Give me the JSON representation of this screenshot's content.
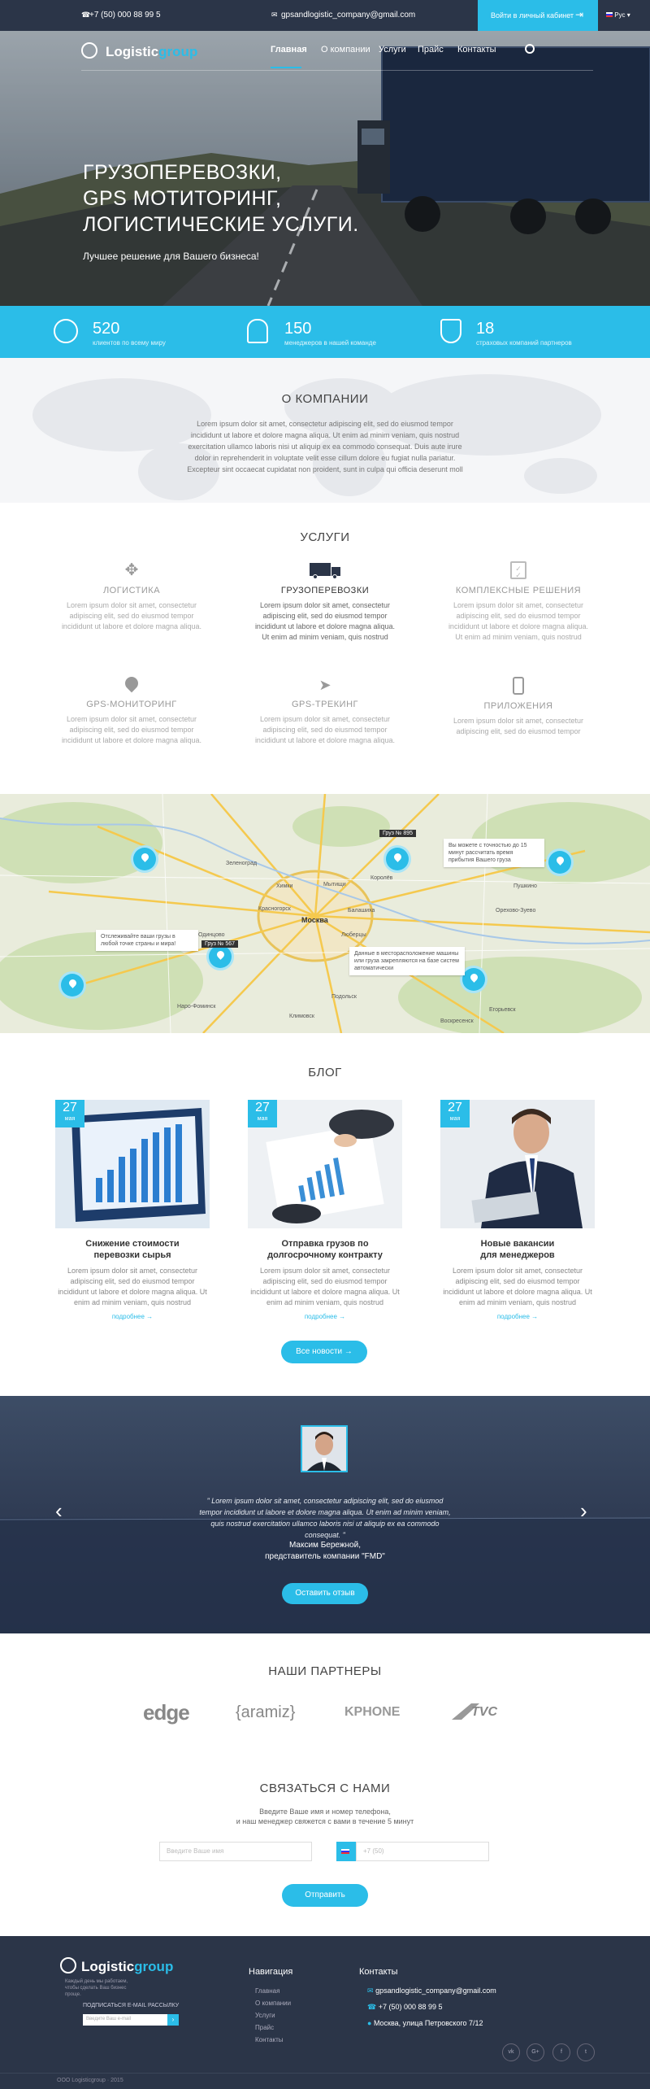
{
  "topbar": {
    "phone": "+7 (50) 000 88 99 5",
    "email": "gpsandlogistic_company@gmail.com",
    "login": "Войти в личный кабинет",
    "lang": "Рус"
  },
  "logo": {
    "main": "Logistic",
    "accent": "group"
  },
  "nav": [
    "Главная",
    "О компании",
    "Услуги",
    "Прайс",
    "Контакты"
  ],
  "hero": {
    "line1": "ГРУЗОПЕРЕВОЗКИ,",
    "line2": "GPS МОТИТОРИНГ,",
    "line3": "ЛОГИСТИЧЕСКИЕ УСЛУГИ.",
    "sub": "Лучшее решение для Вашего бизнеса!"
  },
  "stats": [
    {
      "num": "520",
      "cap": "клиентов по всему миру"
    },
    {
      "num": "150",
      "cap": "менеджеров в нашей команде"
    },
    {
      "num": "18",
      "cap": "страховых компаний партнеров"
    }
  ],
  "about": {
    "title": "О КОМПАНИИ",
    "text": "Lorem ipsum dolor sit amet, consectetur adipiscing elit, sed do eiusmod tempor incididunt ut labore et dolore magna aliqua. Ut enim ad minim veniam, quis nostrud exercitation ullamco laboris nisi ut aliquip ex ea commodo consequat. Duis aute irure dolor in reprehenderit in voluptate velit esse cillum dolore eu fugiat nulla pariatur. Excepteur sint occaecat cupidatat non proident, sunt in culpa qui officia deserunt moll"
  },
  "services": {
    "title": "УСЛУГИ",
    "items": [
      {
        "title": "ЛОГИСТИКА",
        "text": "Lorem ipsum dolor sit amet, consectetur adipiscing elit, sed do eiusmod tempor incididunt ut labore et dolore magna aliqua."
      },
      {
        "title": "ГРУЗОПЕРЕВОЗКИ",
        "text": "Lorem ipsum dolor sit amet, consectetur adipiscing elit, sed do eiusmod tempor incididunt ut labore et dolore magna aliqua. Ut enim ad minim veniam, quis nostrud"
      },
      {
        "title": "КОМПЛЕКСНЫЕ РЕШЕНИЯ",
        "text": "Lorem ipsum dolor sit amet, consectetur adipiscing elit, sed do eiusmod tempor incididunt ut labore et dolore magna aliqua. Ut enim ad minim veniam, quis nostrud"
      },
      {
        "title": "GPS-МОНИТОРИНГ",
        "text": "Lorem ipsum dolor sit amet, consectetur adipiscing elit, sed do eiusmod tempor incididunt ut labore et dolore magna aliqua."
      },
      {
        "title": "GPS-ТРЕКИНГ",
        "text": "Lorem ipsum dolor sit amet, consectetur adipiscing elit, sed do eiusmod tempor incididunt ut labore et dolore magna aliqua."
      },
      {
        "title": "ПРИЛОЖЕНИЯ",
        "text": "Lorem ipsum dolor sit amet, consectetur adipiscing elit, sed do eiusmod tempor"
      }
    ]
  },
  "map": {
    "tip1": "Отслеживайте ваши грузы в любой точке страны и мира!",
    "tip2": "Данные в месторасположение машины или груза закрепляются на базе систем автоматически",
    "tip3": "Вы можете с точностью до 15 минут рассчитать время прибытия Вашего груза",
    "tag1": "Груз № 567",
    "tag2": "Груз № 895",
    "places": [
      "Москва",
      "Зеленоград",
      "Мытищи",
      "Химки",
      "Красногорск",
      "Балашиха",
      "Люберцы",
      "Подольск",
      "Одинцово",
      "Королёв",
      "Пушкино",
      "Орехово-Зуево",
      "Наро-Фоминск",
      "Воскресенск",
      "Егорьевск",
      "Климовск"
    ]
  },
  "blog": {
    "title": "БЛОГ",
    "posts": [
      {
        "day": "27",
        "month": "мая",
        "title": "Снижение стоимости перевозки сырья",
        "text": "Lorem ipsum dolor sit amet, consectetur adipiscing elit, sed do eiusmod tempor incididunt ut labore et dolore magna aliqua. Ut enim ad minim veniam, quis nostrud",
        "more": "подробнее →"
      },
      {
        "day": "27",
        "month": "мая",
        "title": "Отправка грузов по долгосрочному контракту",
        "text": "Lorem ipsum dolor sit amet, consectetur adipiscing elit, sed do eiusmod tempor incididunt ut labore et dolore magna aliqua. Ut enim ad minim veniam, quis nostrud",
        "more": "подробнее →"
      },
      {
        "day": "27",
        "month": "мая",
        "title": "Новые вакансии для менеджеров",
        "text": "Lorem ipsum dolor sit amet, consectetur adipiscing elit, sed do eiusmod tempor incididunt ut labore et dolore magna aliqua. Ut enim ad minim veniam, quis nostrud",
        "more": "подробнее →"
      }
    ],
    "all": "Все новости →"
  },
  "testimonial": {
    "quote": "\" Lorem ipsum dolor sit amet, consectetur adipiscing elit, sed do eiusmod tempor incididunt ut labore et dolore magna aliqua. Ut enim ad minim veniam, quis nostrud exercitation ullamco laboris nisi ut aliquip ex ea commodo consequat. \"",
    "name": "Максим Бережной,",
    "role": "представитель компании \"FMD\"",
    "button": "Оставить отзыв"
  },
  "partners": {
    "title": "НАШИ ПАРТНЕРЫ",
    "logos": [
      "edge",
      "{aramiz}",
      "KPHONE",
      "TVC"
    ]
  },
  "contact": {
    "title": "СВЯЗАТЬСЯ С НАМИ",
    "sub1": "Введите Ваше имя и номер телефона,",
    "sub2": "и наш менеджер свяжется с вами в течение 5 минут",
    "name_ph": "Введите Ваше имя",
    "phone_ph": "+7 (50)",
    "button": "Отправить"
  },
  "footer": {
    "tagline": "Каждый день мы работаем, чтобы сделать Ваш бизнес проще.",
    "subscribe": "ПОДПИСАТЬСЯ E-MAIL РАССЫЛКУ",
    "sub_ph": "Введите Ваш e-mail",
    "nav_title": "Навигация",
    "nav": [
      "Главная",
      "О компании",
      "Услуги",
      "Прайс",
      "Контакты"
    ],
    "contacts_title": "Контакты",
    "email": "gpsandlogistic_company@gmail.com",
    "phone": "+7 (50) 000 88 99 5",
    "address": "Москва, улица Петровского 7/12",
    "copyright": "ООО Logisticgroup · 2015",
    "social": [
      "vk",
      "G+",
      "f",
      "t"
    ]
  }
}
